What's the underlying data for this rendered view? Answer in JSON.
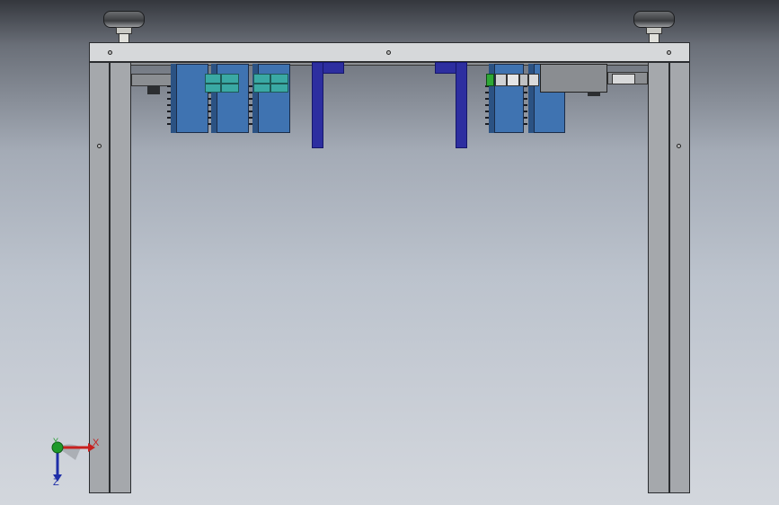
{
  "viewport": {
    "background_top": "#34373d",
    "background_bottom": "#d3d7dd"
  },
  "colors": {
    "frame": "#a5a8ac",
    "frame_top": "#d6d8da",
    "module_blue": "#3f73b1",
    "terminal_teal": "#3aa9a4",
    "bracket_navy": "#2d2ea0",
    "indicator_green": "#2ea836"
  },
  "triad": {
    "x_label": "X",
    "y_label": "Y",
    "z_label": "Z",
    "x_color": "#c8201e",
    "y_color": "#1e9a2a",
    "z_color": "#1f2fa8"
  }
}
